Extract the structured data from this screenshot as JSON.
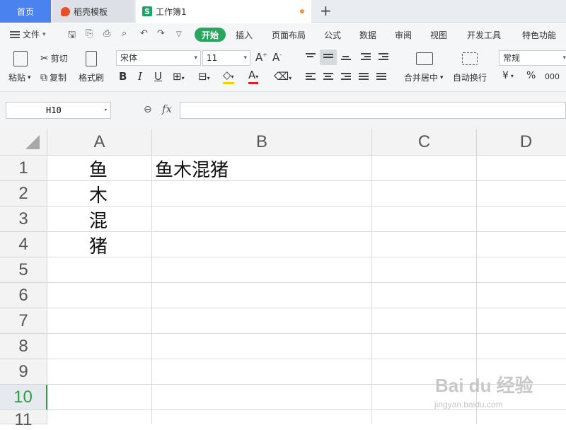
{
  "tabs": {
    "home": "首页",
    "template": "稻壳模板",
    "workbook": "工作簿1",
    "new_tab": "+"
  },
  "menu": {
    "file": "文件",
    "items": [
      "开始",
      "插入",
      "页面布局",
      "公式",
      "数据",
      "审阅",
      "视图",
      "开发工具",
      "特色功能"
    ]
  },
  "ribbon": {
    "paste": "粘贴",
    "cut": "剪切",
    "copy": "复制",
    "format_painter": "格式刷",
    "font_name": "宋体",
    "font_size": "11",
    "merge_center": "合并居中",
    "wrap_text": "自动换行",
    "number_format": "常规",
    "currency": "¥",
    "percent": "%",
    "thousands": "000"
  },
  "formula_bar": {
    "name_box": "H10",
    "fx": "fx",
    "formula": ""
  },
  "grid": {
    "columns": [
      "A",
      "B",
      "C",
      "D"
    ],
    "rows": [
      "1",
      "2",
      "3",
      "4",
      "5",
      "6",
      "7",
      "8",
      "9",
      "10",
      "11"
    ],
    "active_row": "10",
    "cells": {
      "A1": "鱼",
      "A2": "木",
      "A3": "混",
      "A4": "猪",
      "B1": "鱼木混猪"
    }
  },
  "watermark": {
    "brand": "Bai du 经验",
    "url": "jingyan.baidu.com"
  },
  "colors": {
    "accent_green": "#28a55f",
    "home_tab_blue": "#4a82f0",
    "active_row_green": "#2f9e44"
  }
}
